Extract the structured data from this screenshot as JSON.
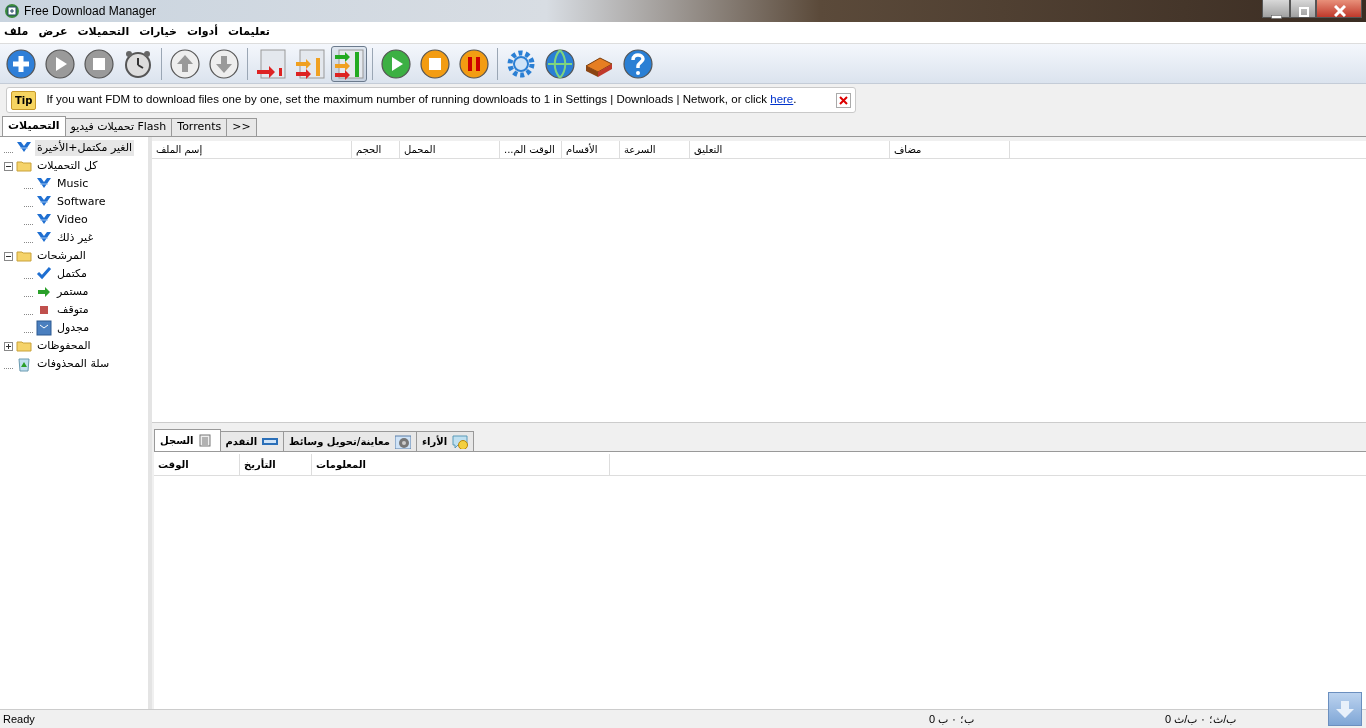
{
  "window": {
    "title": "Free Download Manager"
  },
  "menu": [
    "تعليمات",
    "أدوات",
    "خيارات",
    "التحميلات",
    "عرض",
    "ملف"
  ],
  "toolbar": [
    {
      "kind": "add",
      "selected": false
    },
    {
      "kind": "play",
      "selected": false
    },
    {
      "kind": "stop",
      "selected": false
    },
    {
      "kind": "clock",
      "selected": false
    },
    {
      "kind": "sep"
    },
    {
      "kind": "up",
      "selected": false
    },
    {
      "kind": "down",
      "selected": false
    },
    {
      "kind": "sep"
    },
    {
      "kind": "bar1",
      "selected": false
    },
    {
      "kind": "bar2",
      "selected": false
    },
    {
      "kind": "bar3",
      "selected": true
    },
    {
      "kind": "sep"
    },
    {
      "kind": "gplay",
      "selected": false
    },
    {
      "kind": "ostop",
      "selected": false
    },
    {
      "kind": "opause",
      "selected": false
    },
    {
      "kind": "sep"
    },
    {
      "kind": "gear",
      "selected": false
    },
    {
      "kind": "globe",
      "selected": false
    },
    {
      "kind": "books",
      "selected": false
    },
    {
      "kind": "help",
      "selected": false
    }
  ],
  "tip": {
    "badge": "Tip",
    "text": "If you want FDM to download files one by one, set the maximum number of running downloads to 1 in Settings | Downloads | Network, or click",
    "link": "here",
    "after": "."
  },
  "tabs": [
    {
      "label": ">>",
      "selected": false
    },
    {
      "label": "Torrents",
      "selected": false
    },
    {
      "label": "تحميلات فيديو Flash",
      "selected": false
    },
    {
      "label": "التحميلات",
      "selected": true
    }
  ],
  "tree": [
    {
      "label": "الغير مكتمل+الأخيرة",
      "kind": "download",
      "selected": true
    },
    {
      "label": "كل التحميلات",
      "kind": "folder",
      "expanded": true,
      "selected": false,
      "children": [
        {
          "label": "Music",
          "kind": "download",
          "selected": false
        },
        {
          "label": "Software",
          "kind": "download",
          "selected": false
        },
        {
          "label": "Video",
          "kind": "download",
          "selected": false
        },
        {
          "label": "غير ذلك",
          "kind": "download",
          "selected": false
        }
      ]
    },
    {
      "label": "المرشحات",
      "kind": "folder",
      "expanded": true,
      "selected": false,
      "children": [
        {
          "label": "مكتمل",
          "kind": "done",
          "selected": false
        },
        {
          "label": "مستمر",
          "kind": "running",
          "selected": false
        },
        {
          "label": "متوقف",
          "kind": "stopped",
          "selected": false
        },
        {
          "label": "مجدول",
          "kind": "scheduled",
          "selected": false
        }
      ]
    },
    {
      "label": "المحفوظات",
      "kind": "folder",
      "expanded": false,
      "selected": false
    },
    {
      "label": "سلة المحذوفات",
      "kind": "trash",
      "selected": false
    }
  ],
  "table": {
    "columns": [
      "مضاف",
      "التعليق",
      "السرعة",
      "الأقسام",
      "...الوقت الم",
      "المحمل",
      "الحجم",
      "إسم الملف"
    ]
  },
  "bottom_tabs": [
    {
      "label": "الأراء",
      "kind": "opinions",
      "selected": false
    },
    {
      "label": "معاينة/تحويل وسائط",
      "kind": "media",
      "selected": false
    },
    {
      "label": "التقدم",
      "kind": "progress",
      "selected": false
    },
    {
      "label": "السجل",
      "kind": "log",
      "selected": true
    }
  ],
  "log_table": {
    "columns": [
      "المعلومات",
      "التأريخ",
      "الوقت"
    ]
  },
  "status_bar": {
    "text": "Ready",
    "traffic": "ب؛ ۰ ب 0",
    "speed": "ب/ث؛ ۰ ب/ث 0"
  }
}
